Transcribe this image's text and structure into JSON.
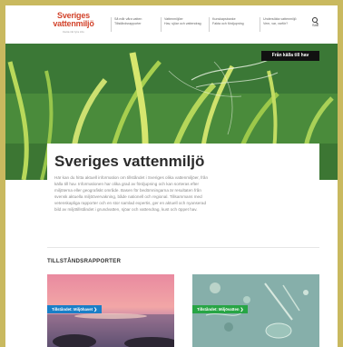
{
  "header": {
    "logo_line1": "Sveriges",
    "logo_line2": "vattenmiljö",
    "logo_tagline": "Detta rikt fyra info",
    "nav": [
      {
        "line1": "Så mår våra vatten",
        "line2": "Tillståndsrapporter"
      },
      {
        "line1": "Vattenmiljöer",
        "line2": "Hav, sjöar och vattendrag"
      },
      {
        "line1": "Kunskapsbanke",
        "line2": "Fakta och fördjupning"
      },
      {
        "line1": "Undersökta vattenmiljö",
        "line2": "Vem, var, varför?"
      }
    ],
    "search_label": "Sök"
  },
  "hero": {
    "button_label": "Från källa till hav"
  },
  "intro": {
    "title": "Sveriges vattenmiljö",
    "body": [
      "Här kan du hitta aktuell information om tillståndet i Sveriges olika vattenmiljöer, från",
      "källa till hav. Informationen har olika grad av fördjupning och kan sorteras efter",
      "miljöterna eller geografiskt område. Basen för bedömningarna är resultaten från",
      "svensk aktuella miljöövervakning, både nationell och regional. Tillsammans med",
      "vetenskapliga rapporter och en stor samlad expertis, ger en aktuell och nyanserad",
      "bild av miljötillståndet i grundvatten, sjöar och vattendrag, kust och öppet hav."
    ]
  },
  "section": {
    "title": "TILLSTÅNDSRAPPORTER"
  },
  "tiles": [
    {
      "label": "Tillståndet: Miljöhavet ❯",
      "accent": "#1a7fc7"
    },
    {
      "label": "Tillståndet: Miljövatten ❯",
      "accent": "#27a545"
    }
  ]
}
